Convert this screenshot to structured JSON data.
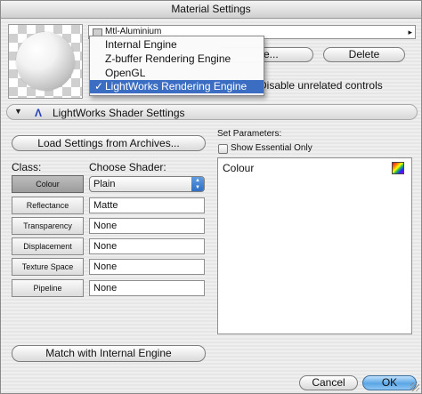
{
  "window": {
    "title": "Material Settings"
  },
  "material": {
    "name": "Mtl-Aluminium"
  },
  "engine_menu": {
    "items": [
      {
        "label": "Internal Engine",
        "checked": false
      },
      {
        "label": "Z-buffer Rendering Engine",
        "checked": false
      },
      {
        "label": "OpenGL",
        "checked": false
      },
      {
        "label": "LightWorks Rendering Engine",
        "checked": true
      }
    ],
    "check_mark": "✓"
  },
  "top_buttons": {
    "edit_partial": "e...",
    "delete": "Delete"
  },
  "options": {
    "disable_unrelated": "Disable unrelated controls"
  },
  "shader_section": {
    "title": "LightWorks Shader Settings"
  },
  "load_button": {
    "label": "Load Settings from Archives..."
  },
  "class_label": "Class:",
  "classes": [
    "Colour",
    "Reflectance",
    "Transparency",
    "Displacement",
    "Texture Space",
    "Pipeline"
  ],
  "active_class": "Colour",
  "shader_label": "Choose Shader:",
  "shaders": {
    "colour": "Plain",
    "reflectance": "Matte",
    "transparency": "None",
    "displacement": "None",
    "texture_space": "None",
    "pipeline": "None"
  },
  "parameters": {
    "title": "Set Parameters:",
    "show_essential": "Show Essential Only",
    "items": [
      "Colour"
    ]
  },
  "match_button": {
    "label": "Match with Internal Engine"
  },
  "footer": {
    "cancel": "Cancel",
    "ok": "OK"
  },
  "colors": {
    "menu_highlight": "#3b6ec2",
    "ok_button": "#5aa6e6"
  }
}
